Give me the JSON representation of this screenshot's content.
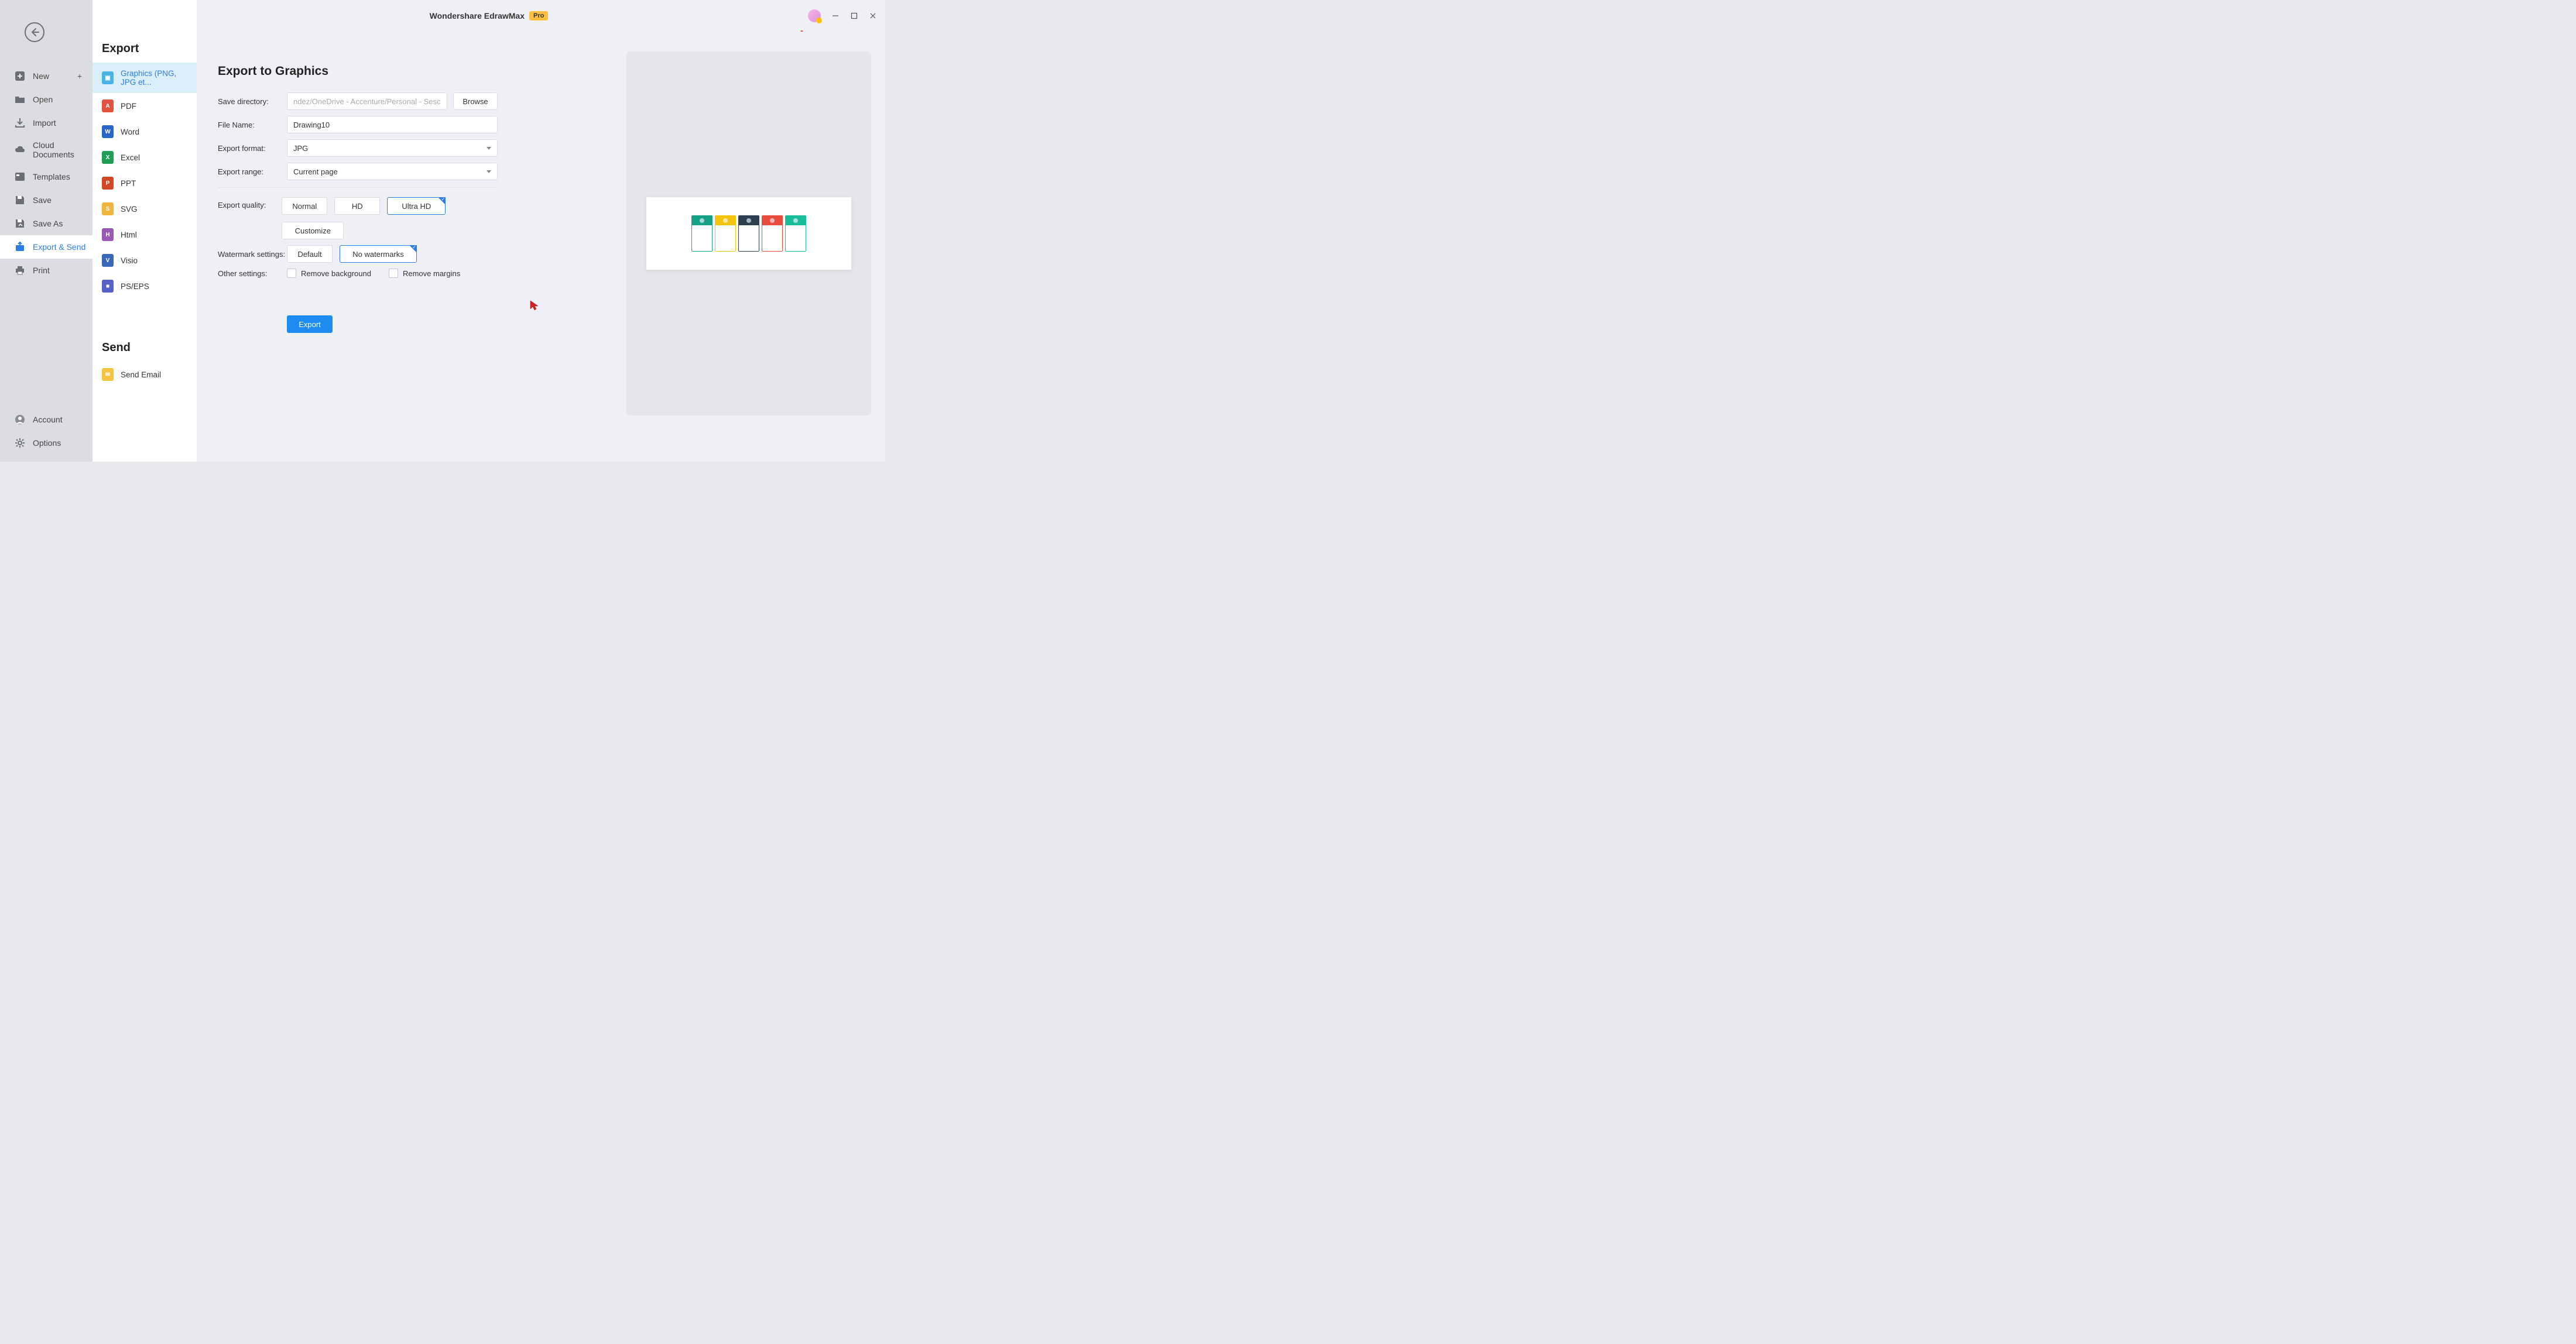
{
  "app": {
    "title": "Wondershare EdrawMax",
    "badge": "Pro"
  },
  "leftnav": {
    "items": [
      {
        "label": "New",
        "plus": true
      },
      {
        "label": "Open"
      },
      {
        "label": "Import"
      },
      {
        "label": "Cloud Documents"
      },
      {
        "label": "Templates"
      },
      {
        "label": "Save"
      },
      {
        "label": "Save As"
      },
      {
        "label": "Export & Send",
        "active": true
      },
      {
        "label": "Print"
      }
    ],
    "bottom": [
      {
        "label": "Account"
      },
      {
        "label": "Options"
      }
    ]
  },
  "export_panel": {
    "heading": "Export",
    "formats": [
      {
        "label": "Graphics (PNG, JPG et...",
        "color": "#48b4e6",
        "selected": true
      },
      {
        "label": "PDF",
        "color": "#e1543f"
      },
      {
        "label": "Word",
        "color": "#2a66c8"
      },
      {
        "label": "Excel",
        "color": "#1f9e55"
      },
      {
        "label": "PPT",
        "color": "#d24726"
      },
      {
        "label": "SVG",
        "color": "#f0b53c"
      },
      {
        "label": "Html",
        "color": "#9b59b6"
      },
      {
        "label": "Visio",
        "color": "#3a67be"
      },
      {
        "label": "PS/EPS",
        "color": "#5560c9"
      }
    ],
    "send_heading": "Send",
    "send_items": [
      {
        "label": "Send Email",
        "color": "#f5c242"
      }
    ]
  },
  "form": {
    "title": "Export to Graphics",
    "save_dir_label": "Save directory:",
    "save_dir_value": "ndez/OneDrive - Accenture/Personal - Sesca Telan",
    "browse": "Browse",
    "file_name_label": "File Name:",
    "file_name_value": "Drawing10",
    "format_label": "Export format:",
    "format_value": "JPG",
    "range_label": "Export range:",
    "range_value": "Current page",
    "quality_label": "Export quality:",
    "quality_options": [
      "Normal",
      "HD",
      "Ultra HD",
      "Customize"
    ],
    "quality_selected": "Ultra HD",
    "watermark_label": "Watermark settings:",
    "watermark_options": [
      "Default",
      "No watermarks"
    ],
    "watermark_selected": "No watermarks",
    "other_label": "Other settings:",
    "remove_bg": "Remove background",
    "remove_margin": "Remove margins",
    "export_btn": "Export"
  }
}
